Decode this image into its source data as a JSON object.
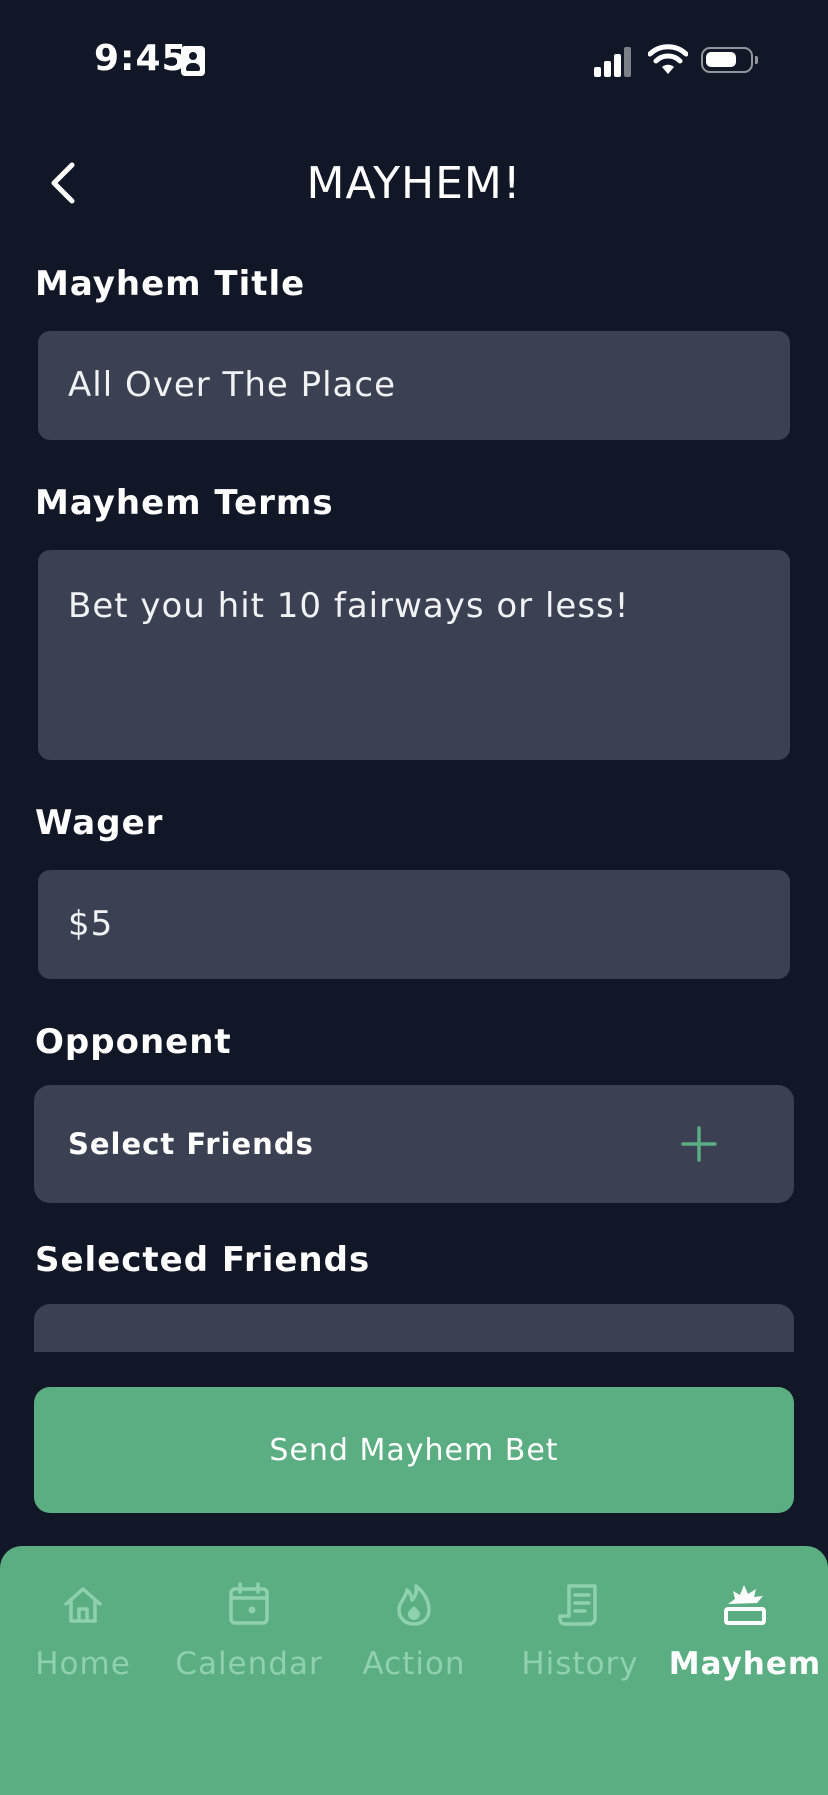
{
  "status_bar": {
    "time": "9:45"
  },
  "header": {
    "title": "MAYHEM!"
  },
  "form": {
    "title_label": "Mayhem Title",
    "title_value": "All Over The Place",
    "terms_label": "Mayhem Terms",
    "terms_value": "Bet you hit 10 fairways or less!",
    "wager_label": "Wager",
    "wager_value": "$5",
    "opponent_label": "Opponent",
    "select_friends": "Select Friends",
    "selected_friends_label": "Selected Friends"
  },
  "send_button": "Send Mayhem Bet",
  "tabbar": {
    "tabs": [
      {
        "label": "Home",
        "icon": "home-icon",
        "active": false
      },
      {
        "label": "Calendar",
        "icon": "calendar-icon",
        "active": false
      },
      {
        "label": "Action",
        "icon": "flame-icon",
        "active": false
      },
      {
        "label": "History",
        "icon": "receipt-icon",
        "active": false
      },
      {
        "label": "Mayhem",
        "icon": "explosion-icon",
        "active": true
      }
    ]
  },
  "colors": {
    "background": "#111726",
    "field": "#3b4152",
    "accent": "#5aae81",
    "inactive_tab": "#8fd1ad"
  }
}
